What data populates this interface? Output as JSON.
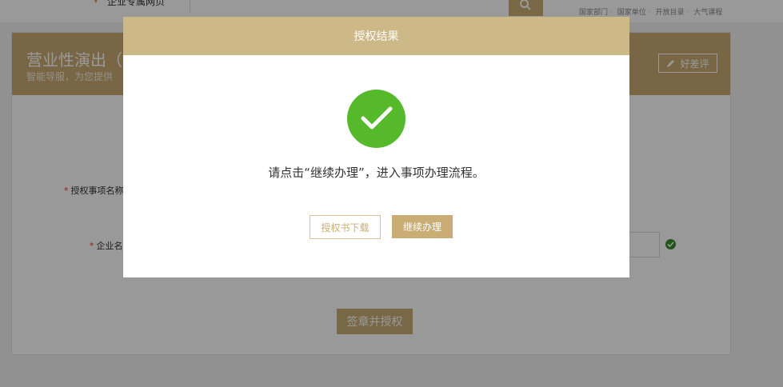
{
  "header": {
    "region_label": "企业专属网页",
    "links": [
      "国家部门",
      "国家单位",
      "开放目录",
      "大气课程"
    ]
  },
  "banner": {
    "title": "营业性演出（",
    "subtitle": "智能导服，为您提供",
    "review_button": "好差评"
  },
  "form": {
    "field1_label": "授权事项名称",
    "field2_label": "企业名",
    "required_mark": "*",
    "submit_button": "签章并授权"
  },
  "modal": {
    "title": "授权结果",
    "message": "请点击“继续办理”，进入事项办理流程。",
    "download_button": "授权书下载",
    "continue_button": "继续办理"
  },
  "colors": {
    "brand_gold": "#c9ad74",
    "modal_header": "#cdb887",
    "success_green": "#55b92b",
    "required_red": "#e23b3b"
  }
}
